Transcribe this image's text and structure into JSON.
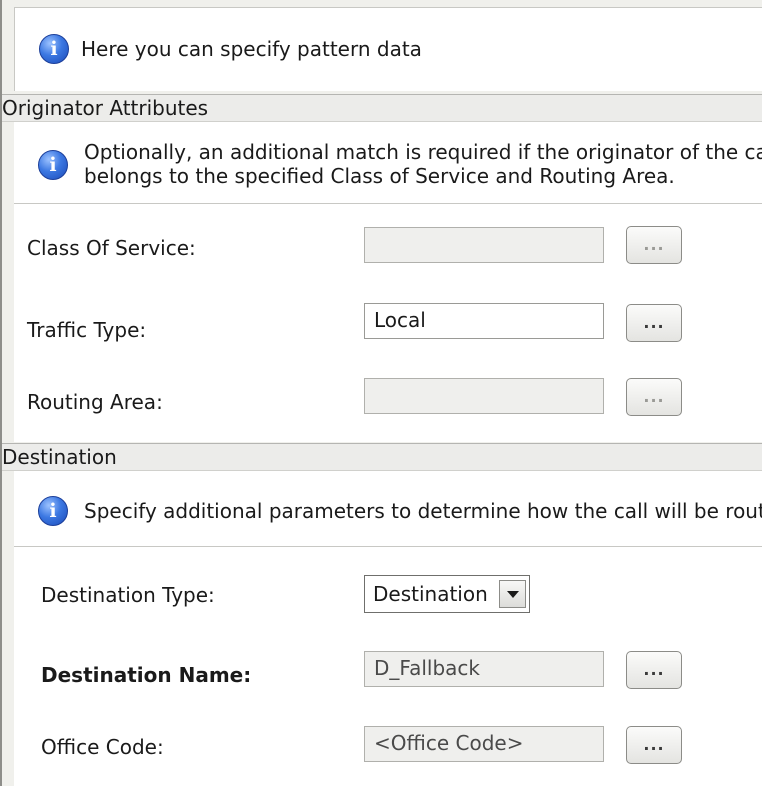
{
  "header_info": {
    "icon": "info-icon",
    "text": "Here you can specify pattern data"
  },
  "originator": {
    "section_title": "Originator Attributes",
    "info_line1": "Optionally, an additional match is required if the originator of the call",
    "info_line2": "belongs to the specified Class of Service and Routing Area.",
    "fields": {
      "class_of_service": {
        "label": "Class Of Service:",
        "value": "",
        "enabled": false,
        "button": "..."
      },
      "traffic_type": {
        "label": "Traffic Type:",
        "value": "Local",
        "enabled": true,
        "button": "..."
      },
      "routing_area": {
        "label": "Routing Area:",
        "value": "",
        "enabled": false,
        "button": "..."
      }
    }
  },
  "destination": {
    "section_title": "Destination",
    "info_text": "Specify additional parameters to determine how the call will be routed.",
    "fields": {
      "destination_type": {
        "label": "Destination Type:",
        "selected": "Destination"
      },
      "destination_name": {
        "label": "Destination Name:",
        "value": "D_Fallback",
        "button": "..."
      },
      "office_code": {
        "label": "Office Code:",
        "value": "<Office Code>",
        "button": "..."
      }
    }
  }
}
